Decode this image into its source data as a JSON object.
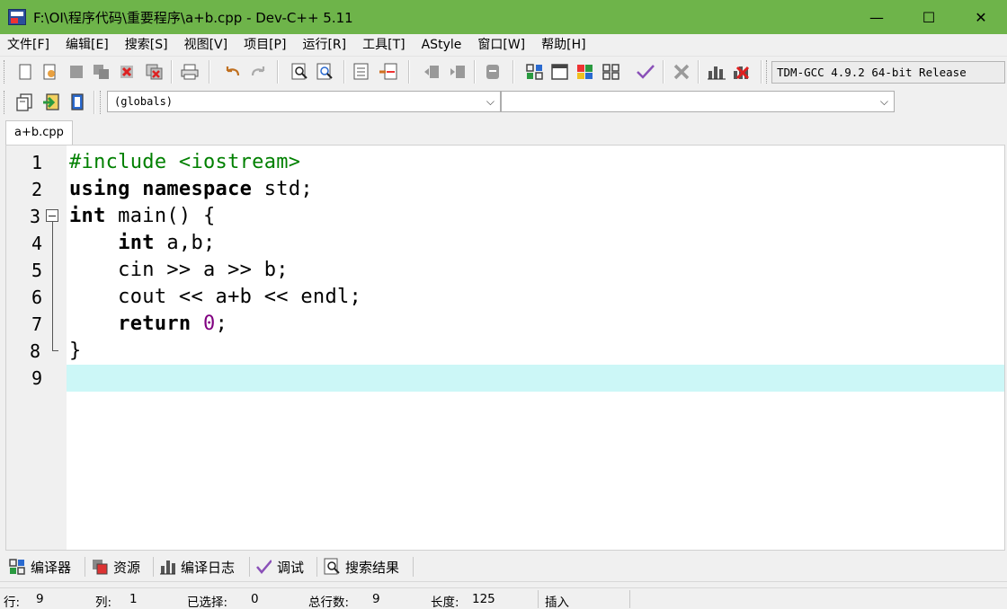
{
  "window": {
    "title": "F:\\OI\\程序代码\\重要程序\\a+b.cpp - Dev-C++ 5.11",
    "minimize": "—",
    "maximize": "☐",
    "close": "✕",
    "titlebar_color": "#6eb44a"
  },
  "menu": [
    "文件[F]",
    "编辑[E]",
    "搜索[S]",
    "视图[V]",
    "项目[P]",
    "运行[R]",
    "工具[T]",
    "AStyle",
    "窗口[W]",
    "帮助[H]"
  ],
  "toolbar": {
    "compiler": "TDM-GCC 4.9.2 64-bit Release",
    "scope_combo": "(globals)",
    "member_combo": ""
  },
  "editor": {
    "tab": "a+b.cpp",
    "line_numbers": [
      "1",
      "2",
      "3",
      "4",
      "5",
      "6",
      "7",
      "8",
      "9"
    ],
    "current_line_color": "#ccf7f7"
  },
  "bottom_tabs": [
    "编译器",
    "资源",
    "编译日志",
    "调试",
    "搜索结果"
  ],
  "status": {
    "row_label": "行:",
    "row_value": "9",
    "col_label": "列:",
    "col_value": "1",
    "sel_label": "已选择:",
    "sel_value": "0",
    "lines_label": "总行数:",
    "lines_value": "9",
    "len_label": "长度:",
    "len_value": "125",
    "mode": "插入"
  }
}
